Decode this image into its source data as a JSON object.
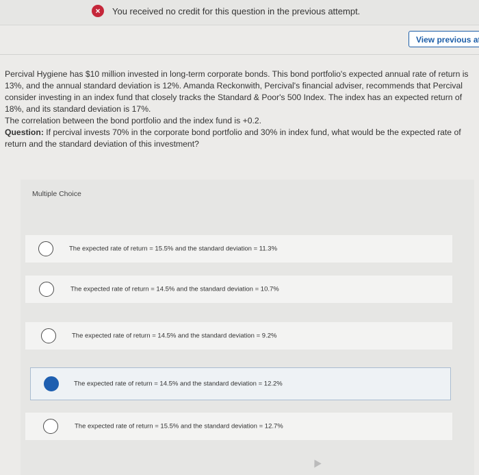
{
  "notice": {
    "icon": "close-circle-icon",
    "text": "You received no credit for this question in the previous attempt."
  },
  "toolbar": {
    "view_previous_label": "View previous att"
  },
  "question": {
    "p1": "Percival Hygiene has $10 million invested in long-term corporate bonds. This bond portfolio's expected annual rate of return is 13%, and the annual standard deviation is 12%. Amanda Reckonwith, Percival's financial adviser, recommends that Percival consider investing in an index fund that closely tracks the Standard & Poor's 500 Index. The index has an expected return of 18%, and its standard deviation is 17%.",
    "p2": "The correlation between the bond portfolio and the index fund is +0.2.",
    "q_label": "Question:",
    "q_text": " If percival invests 70% in the corporate bond portfolio and 30% in index fund, what would be the expected rate of return and the standard deviation of this investment?"
  },
  "multiple_choice": {
    "label": "Multiple Choice",
    "options": [
      {
        "text": "The expected rate of return = 15.5% and the standard deviation = 11.3%",
        "selected": false
      },
      {
        "text": "The expected rate of return = 14.5% and the standard deviation = 10.7%",
        "selected": false
      },
      {
        "text": "The expected rate of return = 14.5% and the standard deviation = 9.2%",
        "selected": false
      },
      {
        "text": "The expected rate of return = 14.5% and the standard deviation = 12.2%",
        "selected": true
      },
      {
        "text": "The expected rate of return = 15.5% and the standard deviation = 12.7%",
        "selected": false
      }
    ]
  },
  "colors": {
    "accent": "#1e5fb0",
    "error": "#c5273a"
  }
}
